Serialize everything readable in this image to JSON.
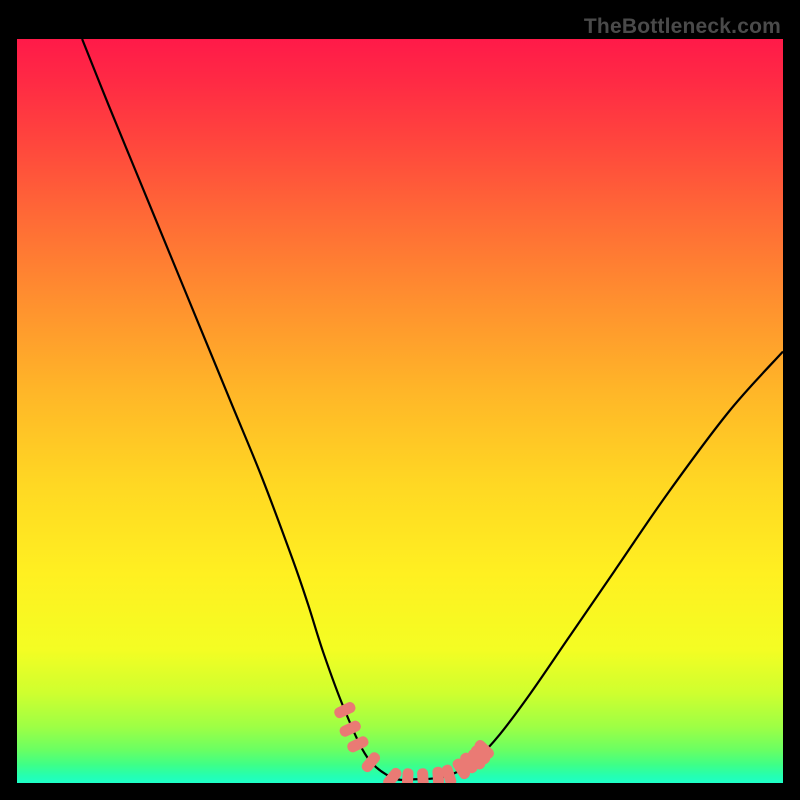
{
  "watermark": "TheBottleneck.com",
  "colors": {
    "black": "#000000",
    "curve": "#000000",
    "marker": "#ea7a74",
    "gradient_stops": [
      {
        "offset": 0.0,
        "color": "#ff1a49"
      },
      {
        "offset": 0.06,
        "color": "#ff2b44"
      },
      {
        "offset": 0.14,
        "color": "#ff463d"
      },
      {
        "offset": 0.24,
        "color": "#ff6a36"
      },
      {
        "offset": 0.35,
        "color": "#ff8f2f"
      },
      {
        "offset": 0.47,
        "color": "#ffb528"
      },
      {
        "offset": 0.6,
        "color": "#ffd823"
      },
      {
        "offset": 0.72,
        "color": "#fff021"
      },
      {
        "offset": 0.82,
        "color": "#f4fd23"
      },
      {
        "offset": 0.88,
        "color": "#ceff2f"
      },
      {
        "offset": 0.925,
        "color": "#9dff45"
      },
      {
        "offset": 0.955,
        "color": "#6bff62"
      },
      {
        "offset": 0.975,
        "color": "#3fff86"
      },
      {
        "offset": 0.99,
        "color": "#25ffb0"
      },
      {
        "offset": 1.0,
        "color": "#1effc8"
      }
    ]
  },
  "chart_data": {
    "type": "line",
    "title": "",
    "xlabel": "",
    "ylabel": "",
    "xlim": [
      0,
      100
    ],
    "ylim": [
      0,
      100
    ],
    "curve": {
      "x": [
        8.5,
        12,
        16,
        20,
        24,
        28,
        32,
        36,
        38,
        40,
        42.7,
        45.7,
        49,
        52,
        55,
        57.5,
        60,
        63,
        67,
        72,
        78,
        85,
        93,
        100
      ],
      "y": [
        100,
        91,
        81,
        71,
        61,
        51,
        41,
        30,
        24,
        17.5,
        10,
        3.5,
        0.7,
        0.5,
        0.7,
        1.5,
        3.2,
        6.5,
        12,
        19.5,
        28.5,
        39,
        50,
        58
      ]
    },
    "markers": {
      "x": [
        42.8,
        43.5,
        44.5,
        46.2,
        49.0,
        51.0,
        53.0,
        55.0,
        56.4,
        58.0,
        59.0,
        60.0,
        60.5,
        61.0
      ],
      "y": [
        9.8,
        7.3,
        5.2,
        2.8,
        0.7,
        0.5,
        0.5,
        0.7,
        1.0,
        1.9,
        2.7,
        3.2,
        3.8,
        4.5
      ]
    }
  }
}
